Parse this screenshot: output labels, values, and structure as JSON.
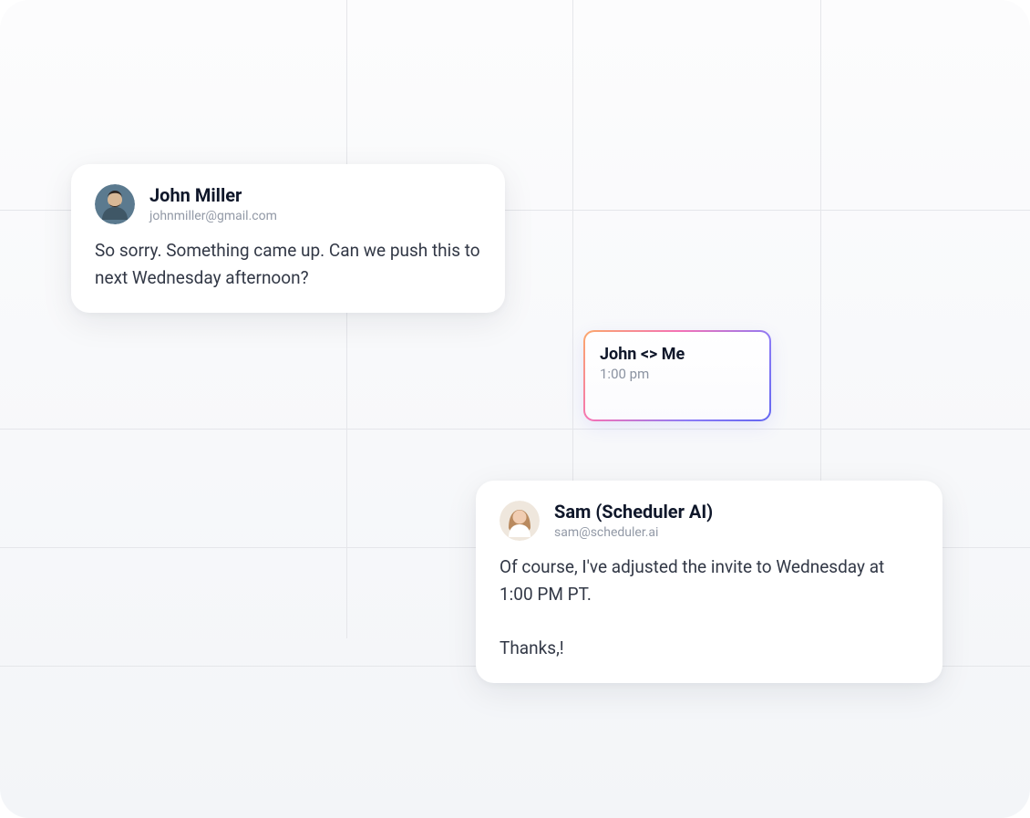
{
  "messages": {
    "john": {
      "name": "John Miller",
      "email": "johnmiller@gmail.com",
      "body": "So sorry. Something came up. Can we push this to next Wednesday afternoon?"
    },
    "sam": {
      "name": "Sam (Scheduler AI)",
      "email": "sam@scheduler.ai",
      "body": "Of course, I've adjusted the invite to Wednesday at 1:00 PM PT.\n\nThanks,!"
    }
  },
  "event": {
    "title": "John <> Me",
    "time": "1:00 pm"
  }
}
